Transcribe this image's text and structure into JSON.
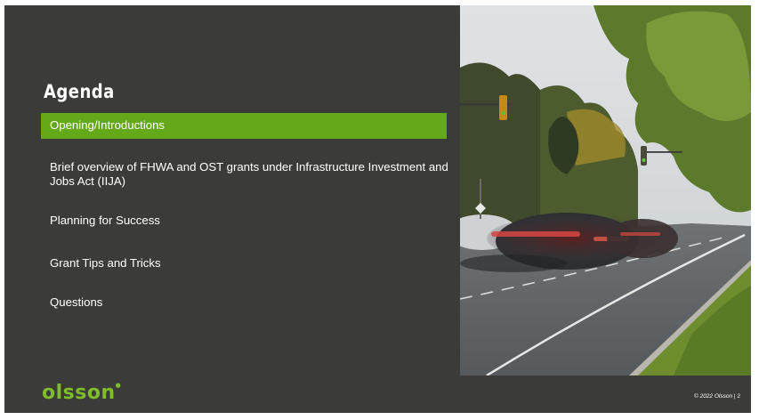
{
  "slide": {
    "title": "Agenda",
    "agenda_items": [
      "Opening/Introductions",
      "Brief overview of FHWA and OST grants under Infrastructure Investment and Jobs Act (IIJA)",
      "Planning for Success",
      "Grant Tips and Tricks",
      "Questions"
    ],
    "active_item_index": 0,
    "logo_text": "olsson",
    "footer_copyright": "© 2022 Olsson",
    "page_number": "| 2"
  },
  "photo": {
    "icon": "street-traffic-photo"
  },
  "colors": {
    "panel_background": "#3b3c3a",
    "accent_green": "#64a919",
    "logo_green": "#7fbd2a",
    "text": "#ffffff"
  }
}
